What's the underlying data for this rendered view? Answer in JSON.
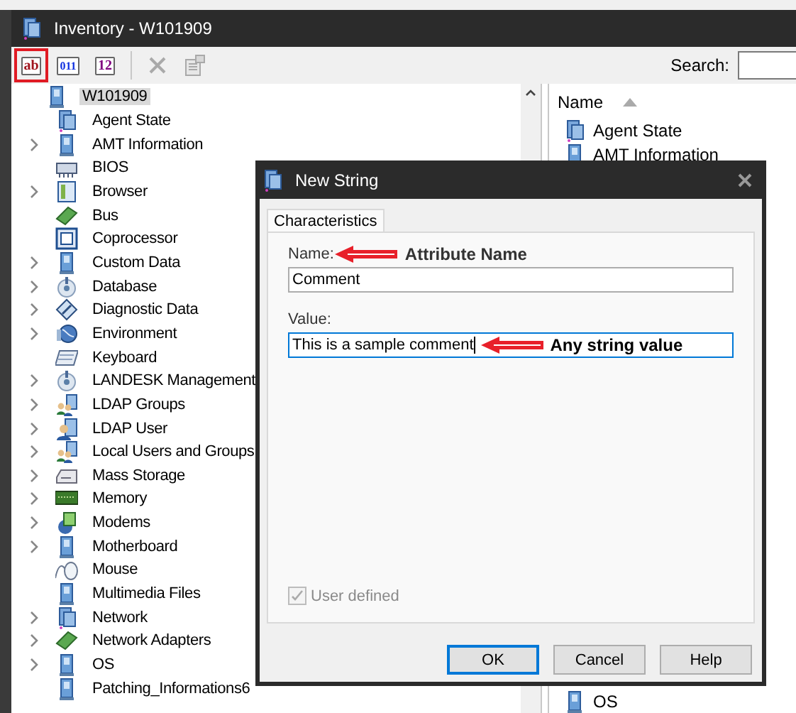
{
  "window": {
    "title": "Inventory - W101909"
  },
  "toolbar": {
    "buttons": [
      {
        "kind": "text",
        "label": "ab",
        "highlighted": true,
        "disabled": false
      },
      {
        "kind": "text",
        "label": "011",
        "highlighted": false,
        "disabled": false
      },
      {
        "kind": "text",
        "label": "12",
        "highlighted": false,
        "disabled": false
      },
      {
        "kind": "delete",
        "highlighted": false,
        "disabled": true
      },
      {
        "kind": "properties",
        "highlighted": false,
        "disabled": true
      }
    ],
    "search": {
      "label": "Search:"
    }
  },
  "tree": {
    "label": "W101909",
    "selected": true,
    "children": [
      {
        "label": "Agent State",
        "expandable": false
      },
      {
        "label": "AMT Information",
        "expandable": true
      },
      {
        "label": "BIOS",
        "expandable": false
      },
      {
        "label": "Browser",
        "expandable": true
      },
      {
        "label": "Bus",
        "expandable": false
      },
      {
        "label": "Coprocessor",
        "expandable": false
      },
      {
        "label": "Custom Data",
        "expandable": true
      },
      {
        "label": "Database",
        "expandable": true
      },
      {
        "label": "Diagnostic Data",
        "expandable": true
      },
      {
        "label": "Environment",
        "expandable": true
      },
      {
        "label": "Keyboard",
        "expandable": false
      },
      {
        "label": "LANDESK Management",
        "expandable": true
      },
      {
        "label": "LDAP Groups",
        "expandable": true
      },
      {
        "label": "LDAP User",
        "expandable": true
      },
      {
        "label": "Local Users and Groups",
        "expandable": true
      },
      {
        "label": "Mass Storage",
        "expandable": true
      },
      {
        "label": "Memory",
        "expandable": true
      },
      {
        "label": "Modems",
        "expandable": true
      },
      {
        "label": "Motherboard",
        "expandable": true
      },
      {
        "label": "Mouse",
        "expandable": false
      },
      {
        "label": "Multimedia Files",
        "expandable": false
      },
      {
        "label": "Network",
        "expandable": true
      },
      {
        "label": "Network Adapters",
        "expandable": true
      },
      {
        "label": "OS",
        "expandable": true
      },
      {
        "label": "Patching_Informations6",
        "expandable": false
      }
    ]
  },
  "list": {
    "header": "Name",
    "rows": [
      {
        "label": "Agent State"
      },
      {
        "label": "AMT Information"
      },
      {
        "label": "OS"
      }
    ]
  },
  "dialog": {
    "title": "New String",
    "tabs": [
      {
        "label": "Characteristics",
        "selected": true
      }
    ],
    "fields": [
      {
        "label": "Name:",
        "value": "Comment",
        "focused": false,
        "label_note": "Attribute Name"
      },
      {
        "label": "Value:",
        "value": "This is a sample comment",
        "focused": true,
        "value_note": "Any string value"
      }
    ],
    "checkbox": {
      "label": "User defined",
      "checked": true,
      "disabled": true
    },
    "buttons": [
      {
        "label": "OK",
        "default": true
      },
      {
        "label": "Cancel",
        "default": false
      },
      {
        "label": "Help",
        "default": false
      }
    ]
  }
}
